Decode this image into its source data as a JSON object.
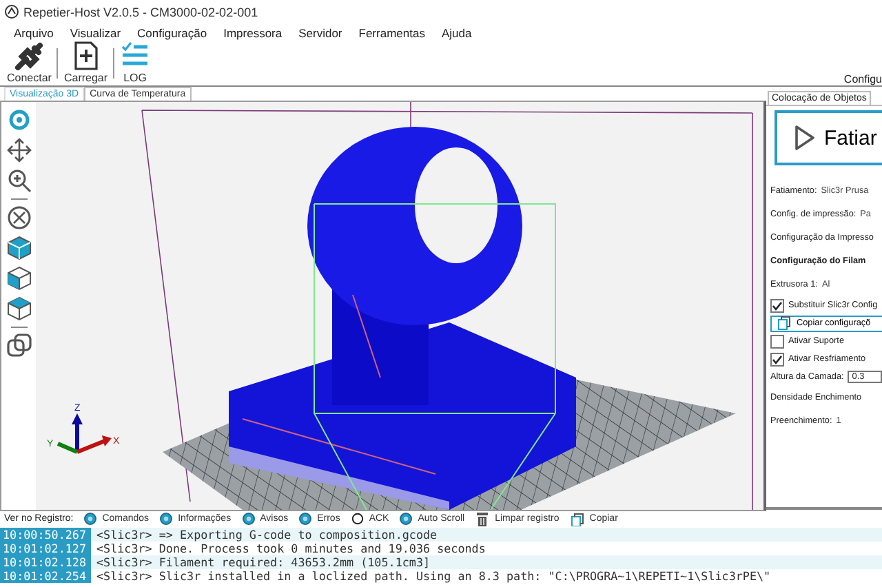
{
  "window": {
    "title": "Repetier-Host V2.0.5 - CM3000-02-02-001"
  },
  "menu": [
    "Arquivo",
    "Visualizar",
    "Configuração",
    "Impressora",
    "Servidor",
    "Ferramentas",
    "Ajuda"
  ],
  "toolbar": {
    "buttons": [
      {
        "label": "Conectar",
        "kind": "connect"
      },
      {
        "label": "Carregar",
        "kind": "load"
      },
      {
        "label": "LOG",
        "kind": "log"
      }
    ],
    "right_label": "Configu"
  },
  "axis_labels": [
    "Z",
    "Y",
    "X"
  ],
  "view_tabs": [
    {
      "label": "Visualização 3D",
      "selected": true
    },
    {
      "label": "Curva de Temperatura",
      "selected": false
    }
  ],
  "side_panel": {
    "tabs": [
      {
        "label": "Colocação de Objetos",
        "selected": false
      }
    ],
    "slice_button": "Fatiar",
    "rows": [
      {
        "kind": "field",
        "label": "Fatiamento:",
        "value": "Slic3r Prusa"
      },
      {
        "kind": "field",
        "label": "Config. de impressão:",
        "value": "Pa"
      },
      {
        "kind": "label",
        "label": "Configuração da Impresso"
      },
      {
        "kind": "heading",
        "label": "Configuração do Filam"
      },
      {
        "kind": "field",
        "label": "Extrusora 1:",
        "value": "Al"
      },
      {
        "kind": "checkbox",
        "label": "Substituir Slic3r Config",
        "checked": true
      },
      {
        "kind": "button",
        "label": "Copiar configuraçõ"
      },
      {
        "kind": "checkbox",
        "label": "Ativar Suporte",
        "checked": false
      },
      {
        "kind": "checkbox",
        "label": "Ativar Resfriamento",
        "checked": true
      },
      {
        "kind": "input",
        "label": "Altura da Camada:",
        "value": "0.3"
      },
      {
        "kind": "label",
        "label": "Densidade Enchimento"
      },
      {
        "kind": "field",
        "label": "Preenchimento:",
        "value": "1"
      }
    ]
  },
  "log": {
    "label": "Ver no Registro:",
    "filters": [
      {
        "label": "Comandos",
        "on": true
      },
      {
        "label": "Informações",
        "on": true
      },
      {
        "label": "Avisos",
        "on": true
      },
      {
        "label": "Erros",
        "on": true
      },
      {
        "label": "ACK",
        "on": false
      },
      {
        "label": "Auto Scroll",
        "on": true
      }
    ],
    "actions": [
      {
        "label": "Limpar registro",
        "kind": "clear"
      },
      {
        "label": "Copiar",
        "kind": "copy"
      }
    ],
    "lines": [
      {
        "time": "10:00:50.267",
        "message": "<Slic3r> => Exporting G-code to composition.gcode"
      },
      {
        "time": "10:01:02.127",
        "message": "<Slic3r> Done. Process took 0 minutes and 19.036 seconds"
      },
      {
        "time": "10:01:02.128",
        "message": "<Slic3r> Filament required: 43653.2mm (105.1cm3]"
      },
      {
        "time": "10:01:02.254",
        "message": "<Slic3r> Slic3r installed in a loclized path. Using an 8.3 path: \"C:\\PROGRA~1\\REPETI~1\\Slic3rPE\\\""
      }
    ]
  }
}
